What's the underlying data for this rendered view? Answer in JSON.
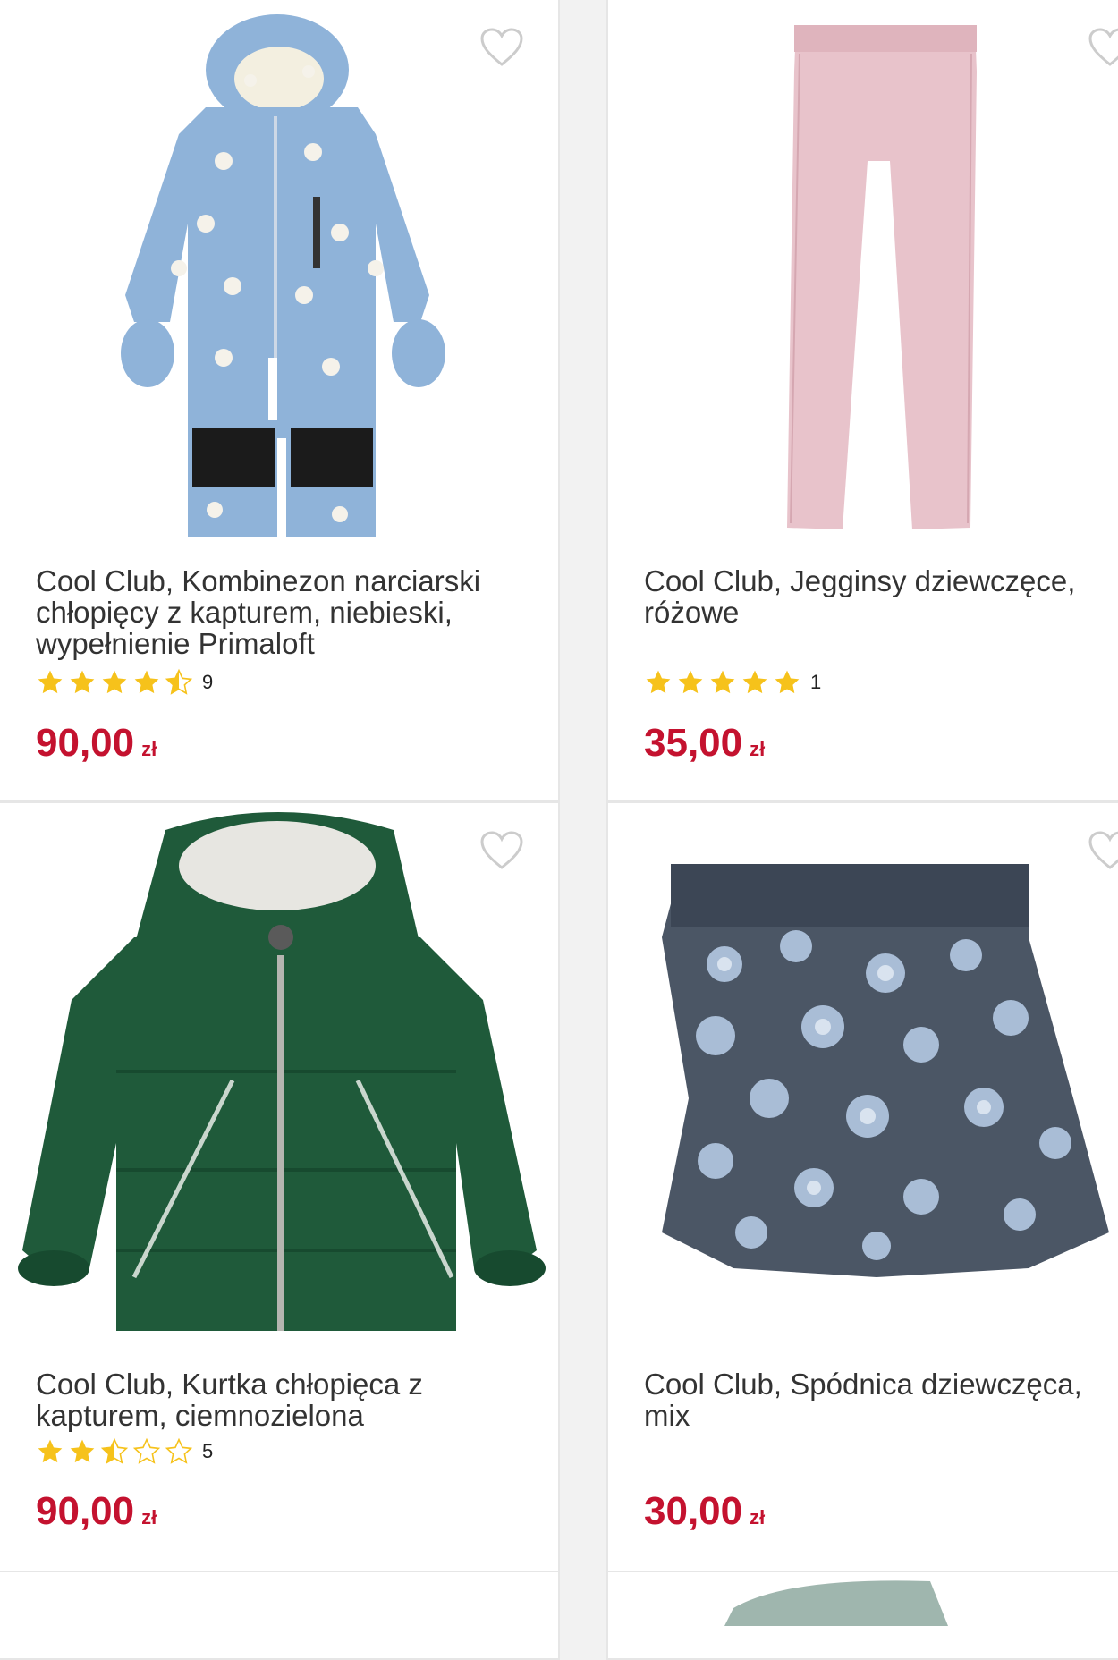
{
  "products": [
    {
      "title": "Cool Club, Kombinezon narciarski chłopięcy z kapturem, niebieski, wypełnienie Primaloft",
      "rating": 4.5,
      "rating_count": "9",
      "price": "90,00",
      "currency": "zł",
      "image": "blue-ski-suit"
    },
    {
      "title": "Cool Club, Jegginsy dziewczęce, różowe",
      "rating": 5,
      "rating_count": "1",
      "price": "35,00",
      "currency": "zł",
      "image": "pink-jeggings"
    },
    {
      "title": "Cool Club, Kurtka chłopięca z kapturem, ciemnozielona",
      "rating": 2.5,
      "rating_count": "5",
      "price": "90,00",
      "currency": "zł",
      "image": "green-jacket"
    },
    {
      "title": "Cool Club, Spódnica dziewczęca, mix",
      "price": "30,00",
      "currency": "zł",
      "image": "floral-skirt"
    }
  ],
  "icons": {
    "favorite": "heart-outline-icon",
    "star_full": "star-filled-icon",
    "star_half": "star-half-icon",
    "star_empty": "star-empty-icon"
  },
  "colors": {
    "price": "#c4122f",
    "star": "#f6c21b",
    "heart": "#cccccc"
  }
}
